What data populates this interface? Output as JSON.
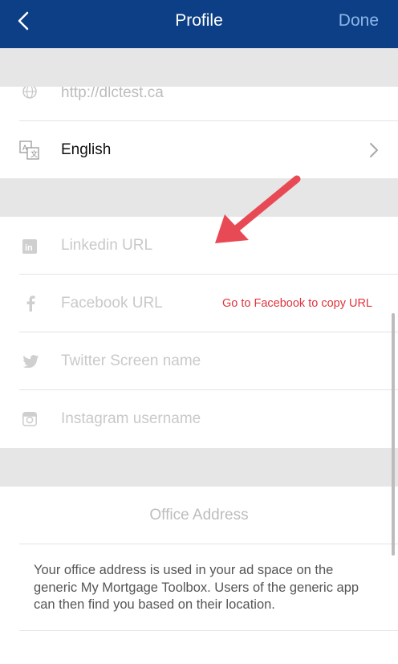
{
  "header": {
    "title": "Profile",
    "done_label": "Done"
  },
  "rows": {
    "website": {
      "value": "http://dlctest.ca"
    },
    "language": {
      "value": "English"
    },
    "linkedin": {
      "placeholder": "Linkedin URL"
    },
    "facebook": {
      "placeholder": "Facebook URL",
      "link_label": "Go to Facebook to copy URL"
    },
    "twitter": {
      "placeholder": "Twitter Screen name"
    },
    "instagram": {
      "placeholder": "Instagram username"
    }
  },
  "office": {
    "title": "Office Address",
    "description": "Your office address is used in your ad space on the generic My Mortgage Toolbox. Users of the generic app can then find you based on their location."
  },
  "colors": {
    "nav_bar": "#0d3f86",
    "done_text": "#8eb6e8",
    "link_red": "#e0353d",
    "annotation_arrow": "#e84a55"
  },
  "icons": [
    "back-chevron-icon",
    "globe-icon",
    "translate-icon",
    "chevron-right-icon",
    "linkedin-icon",
    "facebook-icon",
    "twitter-icon",
    "instagram-icon",
    "annotation-arrow"
  ]
}
